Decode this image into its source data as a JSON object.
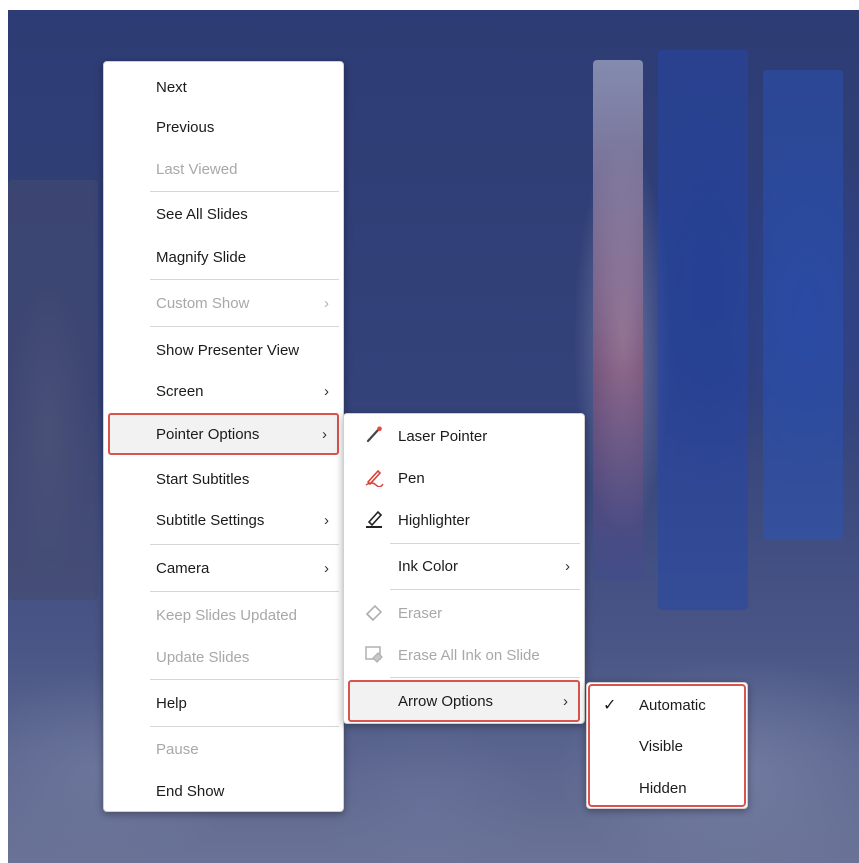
{
  "main_menu": [
    {
      "id": "next",
      "label": "Next",
      "disabled": false
    },
    {
      "id": "previous",
      "label": "Previous",
      "disabled": false
    },
    {
      "id": "last-viewed",
      "label": "Last Viewed",
      "disabled": true
    },
    {
      "id": "see-all-slides",
      "label": "See All Slides",
      "disabled": false
    },
    {
      "id": "magnify-slide",
      "label": "Magnify Slide",
      "disabled": false
    },
    {
      "id": "custom-show",
      "label": "Custom Show",
      "disabled": true,
      "arrow": "›"
    },
    {
      "id": "show-presenter-view",
      "label": "Show Presenter View",
      "disabled": false
    },
    {
      "id": "screen",
      "label": "Screen",
      "disabled": false,
      "arrow": "›"
    },
    {
      "id": "pointer-options",
      "label": "Pointer Options",
      "disabled": false,
      "arrow": "›"
    },
    {
      "id": "start-subtitles",
      "label": "Start Subtitles",
      "disabled": false
    },
    {
      "id": "subtitle-settings",
      "label": "Subtitle Settings",
      "disabled": false,
      "arrow": "›"
    },
    {
      "id": "camera",
      "label": "Camera",
      "disabled": false,
      "arrow": "›"
    },
    {
      "id": "keep-slides-updated",
      "label": "Keep Slides Updated",
      "disabled": true
    },
    {
      "id": "update-slides",
      "label": "Update Slides",
      "disabled": true
    },
    {
      "id": "help",
      "label": "Help",
      "disabled": false
    },
    {
      "id": "pause",
      "label": "Pause",
      "disabled": true
    },
    {
      "id": "end-show",
      "label": "End Show",
      "disabled": false
    }
  ],
  "pointer_menu": [
    {
      "id": "laser-pointer",
      "label": "Laser Pointer",
      "disabled": false,
      "icon": "laser-pointer-icon"
    },
    {
      "id": "pen",
      "label": "Pen",
      "disabled": false,
      "icon": "pen-icon"
    },
    {
      "id": "highlighter",
      "label": "Highlighter",
      "disabled": false,
      "icon": "highlighter-icon"
    },
    {
      "id": "ink-color",
      "label": "Ink Color",
      "disabled": false,
      "arrow": "›"
    },
    {
      "id": "eraser",
      "label": "Eraser",
      "disabled": true,
      "icon": "eraser-icon"
    },
    {
      "id": "erase-all-ink",
      "label": "Erase All Ink on Slide",
      "disabled": true,
      "icon": "erase-all-ink-icon"
    },
    {
      "id": "arrow-options",
      "label": "Arrow Options",
      "disabled": false,
      "arrow": "›"
    }
  ],
  "arrow_menu": [
    {
      "id": "automatic",
      "label": "Automatic",
      "checked": true,
      "check": "✓"
    },
    {
      "id": "visible",
      "label": "Visible",
      "checked": false
    },
    {
      "id": "hidden",
      "label": "Hidden",
      "checked": false
    }
  ],
  "colors": {
    "highlight_border": "#d9534f",
    "disabled_text": "#a8a8a8",
    "menu_bg": "#ffffff"
  }
}
